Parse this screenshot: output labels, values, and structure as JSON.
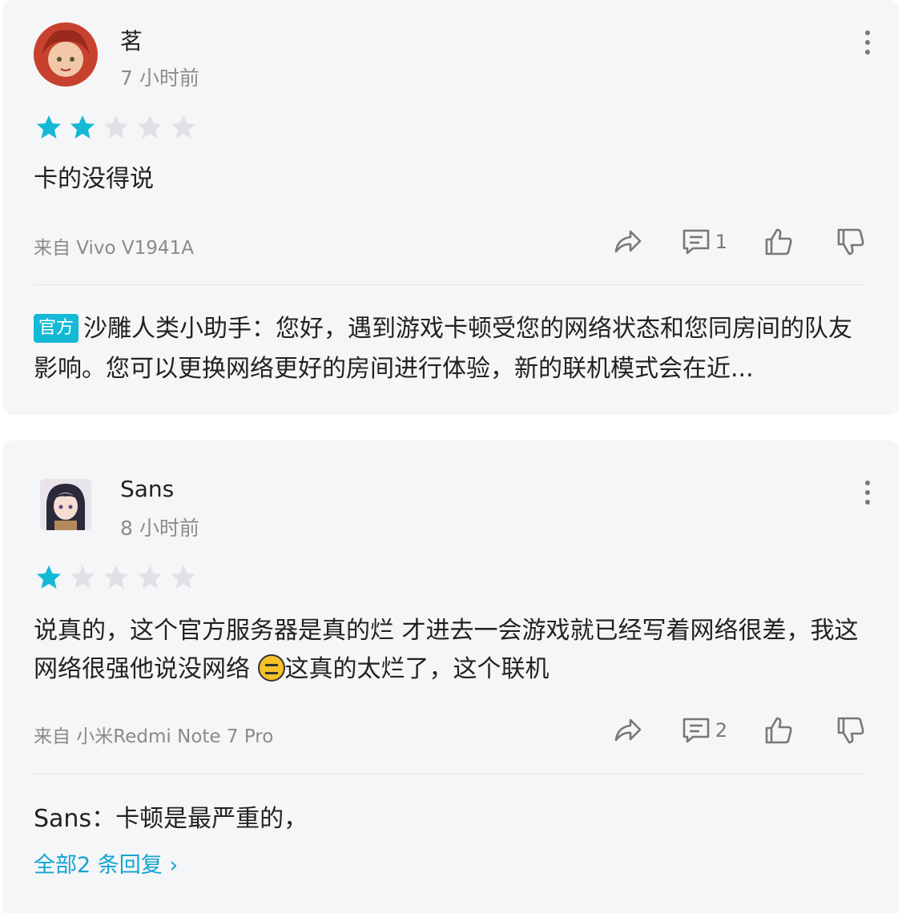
{
  "reviews": [
    {
      "user": "茗",
      "time": "7 小时前",
      "rating": 2,
      "text": "卡的没得说",
      "device": "来自 Vivo V1941A",
      "comment_count": "1",
      "reply_badge": "官方",
      "reply_author": "沙雕人类小助手",
      "reply_sep": "：",
      "reply_text": "您好，遇到游戏卡顿受您的网络状态和您同房间的队友影响。您可以更换网络更好的房间进行体验，新的联机模式会在近..."
    },
    {
      "user": "Sans",
      "time": "8 小时前",
      "rating": 1,
      "text_part1": "说真的，这个官方服务器是真的烂 才进去一会游戏就已经写着网络很差，我这网络很强他说没网络 ",
      "text_part2": "这真的太烂了，这个联机",
      "device": "来自 小米Redmi Note 7 Pro",
      "comment_count": "2",
      "reply_author": "Sans",
      "reply_sep": "：",
      "reply_text": "卡顿是最严重的，",
      "all_replies": "全部2 条回复"
    }
  ],
  "colors": {
    "star_on": "#14b9d5",
    "star_off": "#dfe1e5",
    "accent": "#14a5cf"
  },
  "icons": [
    "share-icon",
    "comment-icon",
    "thumbs-up-icon",
    "thumbs-down-icon",
    "more-icon",
    "star-icon"
  ]
}
